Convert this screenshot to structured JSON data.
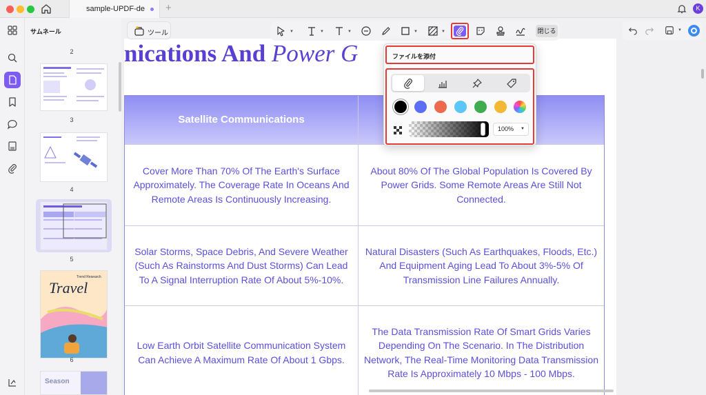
{
  "window": {
    "tab_title": "sample-UPDF-de",
    "new_tab": "+",
    "avatar_initial": "K",
    "accent_color": "#7c5cf1"
  },
  "sidebar": {
    "panel_title": "サムネール",
    "page_numbers": [
      "2",
      "3",
      "4",
      "5",
      "6"
    ],
    "thumb_labels": {
      "travel_title": "Travel",
      "travel_subtitle": "Trend Research",
      "season": "Season"
    },
    "icons": [
      "grid-icon",
      "search-icon",
      "document-icon",
      "bookmark-icon",
      "comment-icon",
      "form-icon",
      "paperclip-icon",
      "layers-icon"
    ]
  },
  "toolbar": {
    "tool_label": "ツール",
    "close_label": "閉じる",
    "tools": [
      "select-icon",
      "text-icon",
      "text-box-icon",
      "comment-icon",
      "pen-icon",
      "shape-icon",
      "pattern-icon",
      "attach-icon",
      "sticker-icon",
      "stamp-icon",
      "signature-icon"
    ]
  },
  "attachment_popup": {
    "title": "ファイルを添付",
    "icon_options": [
      "paperclip-icon",
      "graph-icon",
      "pushpin-icon",
      "tag-icon"
    ],
    "colors": [
      "#000000",
      "#5b6ef5",
      "#ee6a4e",
      "#5cc7f7",
      "#3fac4f",
      "#f3b935",
      "rainbow"
    ],
    "selected_color": "#000000",
    "opacity_value": "100%",
    "opacity_level": 1.0
  },
  "document": {
    "title_bold": "nications And ",
    "title_italic": "Power G",
    "table": {
      "headers": [
        "Satellite Communications",
        ""
      ],
      "rows": [
        [
          "Cover More Than 70% Of The Earth's Surface Approximately. The Coverage Rate In Oceans And Remote Areas Is Continuously Increasing.",
          "About 80% Of The Global Population Is Covered By Power Grids. Some Remote Areas Are Still Not Connected."
        ],
        [
          "Solar Storms, Space Debris, And Severe Weather (Such As Rainstorms And Dust Storms) Can Lead To A Signal Interruption Rate Of About 5%-10%.",
          "Natural Disasters (Such As Earthquakes, Floods, Etc.) And Equipment Aging Lead To About 3%-5% Of Transmission Line Failures Annually."
        ],
        [
          "Low Earth Orbit Satellite Communication System Can Achieve A Maximum Rate Of About 1 Gbps.",
          "The Data Transmission Rate Of Smart Grids Varies Depending On The Scenario. In The Distribution Network, The Real-Time Monitoring Data Transmission Rate Is Approximately 10 Mbps - 100 Mbps."
        ]
      ]
    }
  }
}
